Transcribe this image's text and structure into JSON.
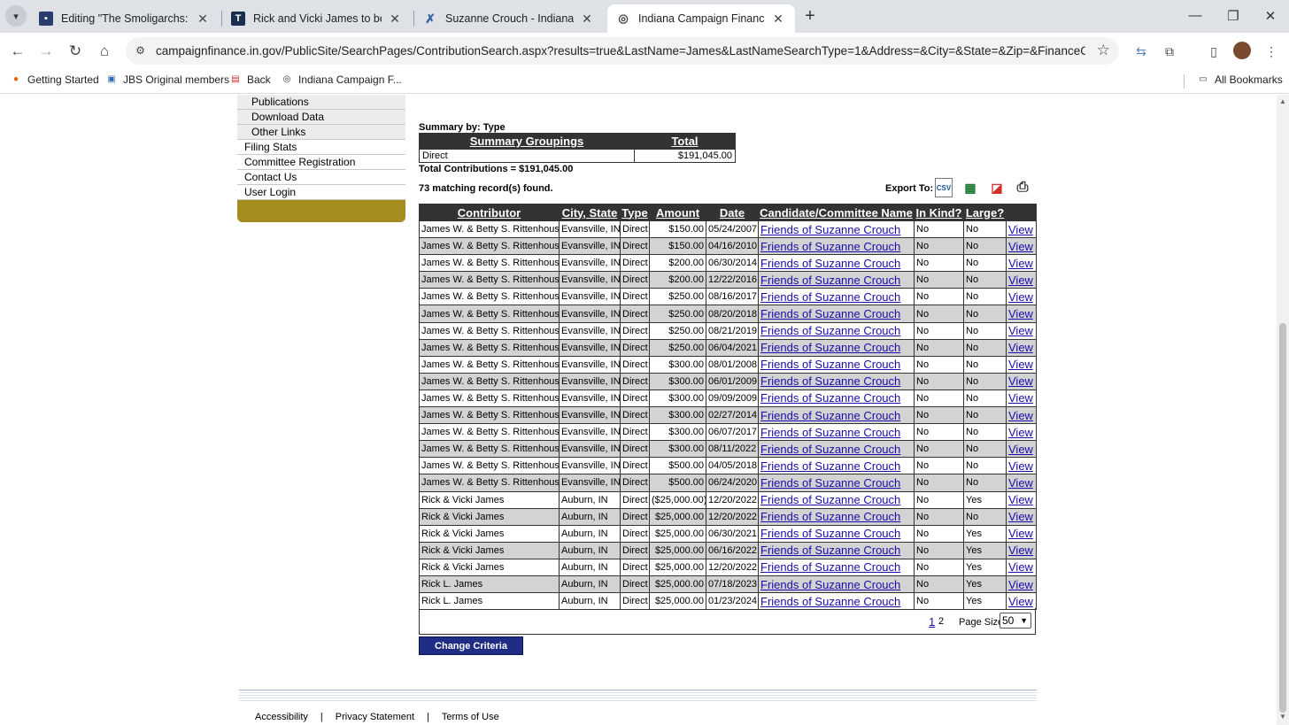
{
  "browser": {
    "tabs": [
      {
        "title": "Editing \"The Smoligarchs: Rick J",
        "icon": "site-favicon",
        "active": false
      },
      {
        "title": "Rick and Vicki James to be hono",
        "icon": "t-favicon",
        "active": false
      },
      {
        "title": "Suzanne Crouch - Indiana Cand",
        "icon": "ballot-favicon",
        "active": false
      },
      {
        "title": "Indiana Campaign Finance - Co",
        "icon": "globe-favicon",
        "active": true
      }
    ],
    "url": "campaignfinance.in.gov/PublicSite/SearchPages/ContributionSearch.aspx?results=true&LastName=James&LastNameSearchType=1&Address=&City=&State=&Zip=&FinanceCategoryID...",
    "bookmarks": [
      {
        "label": "Getting Started",
        "icon": "firefox-icon"
      },
      {
        "label": "JBS Original members",
        "icon": "doc-icon"
      },
      {
        "label": "Back",
        "icon": "back-icon"
      },
      {
        "label": "Indiana Campaign F...",
        "icon": "globe-icon"
      }
    ],
    "all_bookmarks": "All Bookmarks"
  },
  "leftnav": {
    "items": [
      {
        "label": "Publications",
        "sub": true
      },
      {
        "label": "Download Data",
        "sub": true
      },
      {
        "label": "Other Links",
        "sub": true
      },
      {
        "label": "Filing Stats",
        "sub": false
      },
      {
        "label": "Committee Registration",
        "sub": false
      },
      {
        "label": "Contact Us",
        "sub": false
      },
      {
        "label": "User Login",
        "sub": false
      }
    ]
  },
  "summary": {
    "label": "Summary by: Type",
    "headers": [
      "Summary Groupings",
      "Total"
    ],
    "row": [
      "Direct",
      "$191,045.00"
    ],
    "total_line": "Total Contributions = $191,045.00"
  },
  "matching": "73 matching record(s) found.",
  "export_label": "Export To:",
  "export_icons": [
    "csv-icon",
    "excel-icon",
    "pdf-icon",
    "printer-icon"
  ],
  "results": {
    "headers": [
      "Contributor",
      "City, State",
      "Type",
      "Amount",
      "Date",
      "Candidate/Committee Name",
      "In Kind?",
      "Large?",
      ""
    ],
    "rows": [
      [
        "James W. & Betty S. Rittenhouse",
        "Evansville, IN",
        "Direct",
        "$150.00",
        "05/24/2007",
        "Friends of Suzanne Crouch",
        "No",
        "No",
        "View"
      ],
      [
        "James W. & Betty S. Rittenhouse",
        "Evansville, IN",
        "Direct",
        "$150.00",
        "04/16/2010",
        "Friends of Suzanne Crouch",
        "No",
        "No",
        "View"
      ],
      [
        "James W. & Betty S. Rittenhouse",
        "Evansville, IN",
        "Direct",
        "$200.00",
        "06/30/2014",
        "Friends of Suzanne Crouch",
        "No",
        "No",
        "View"
      ],
      [
        "James W. & Betty S. Rittenhouse",
        "Evansville, IN",
        "Direct",
        "$200.00",
        "12/22/2016",
        "Friends of Suzanne Crouch",
        "No",
        "No",
        "View"
      ],
      [
        "James W. & Betty S. Rittenhouse",
        "Evansville, IN",
        "Direct",
        "$250.00",
        "08/16/2017",
        "Friends of Suzanne Crouch",
        "No",
        "No",
        "View"
      ],
      [
        "James W. & Betty S. Rittenhouse",
        "Evansville, IN",
        "Direct",
        "$250.00",
        "08/20/2018",
        "Friends of Suzanne Crouch",
        "No",
        "No",
        "View"
      ],
      [
        "James W. & Betty S. Rittenhouse",
        "Evansville, IN",
        "Direct",
        "$250.00",
        "08/21/2019",
        "Friends of Suzanne Crouch",
        "No",
        "No",
        "View"
      ],
      [
        "James W. & Betty S. Rittenhouse",
        "Evansville, IN",
        "Direct",
        "$250.00",
        "06/04/2021",
        "Friends of Suzanne Crouch",
        "No",
        "No",
        "View"
      ],
      [
        "James W. & Betty S. Rittenhouse",
        "Evansville, IN",
        "Direct",
        "$300.00",
        "08/01/2008",
        "Friends of Suzanne Crouch",
        "No",
        "No",
        "View"
      ],
      [
        "James W. & Betty S. Rittenhouse",
        "Evansville, IN",
        "Direct",
        "$300.00",
        "06/01/2009",
        "Friends of Suzanne Crouch",
        "No",
        "No",
        "View"
      ],
      [
        "James W. & Betty S. Rittenhouse",
        "Evansville, IN",
        "Direct",
        "$300.00",
        "09/09/2009",
        "Friends of Suzanne Crouch",
        "No",
        "No",
        "View"
      ],
      [
        "James W. & Betty S. Rittenhouse",
        "Evansville, IN",
        "Direct",
        "$300.00",
        "02/27/2014",
        "Friends of Suzanne Crouch",
        "No",
        "No",
        "View"
      ],
      [
        "James W. & Betty S. Rittenhouse",
        "Evansville, IN",
        "Direct",
        "$300.00",
        "06/07/2017",
        "Friends of Suzanne Crouch",
        "No",
        "No",
        "View"
      ],
      [
        "James W. & Betty S. Rittenhouse",
        "Evansville, IN",
        "Direct",
        "$300.00",
        "08/11/2022",
        "Friends of Suzanne Crouch",
        "No",
        "No",
        "View"
      ],
      [
        "James W. & Betty S. Rittenhouse",
        "Evansville, IN",
        "Direct",
        "$500.00",
        "04/05/2018",
        "Friends of Suzanne Crouch",
        "No",
        "No",
        "View"
      ],
      [
        "James W. & Betty S. Rittenhouse",
        "Evansville, IN",
        "Direct",
        "$500.00",
        "06/24/2020",
        "Friends of Suzanne Crouch",
        "No",
        "No",
        "View"
      ],
      [
        "Rick & Vicki James",
        "Auburn, IN",
        "Direct",
        "($25,000.00)",
        "12/20/2022",
        "Friends of Suzanne Crouch",
        "No",
        "Yes",
        "View"
      ],
      [
        "Rick & Vicki James",
        "Auburn, IN",
        "Direct",
        "$25,000.00",
        "12/20/2022",
        "Friends of Suzanne Crouch",
        "No",
        "No",
        "View"
      ],
      [
        "Rick & Vicki James",
        "Auburn, IN",
        "Direct",
        "$25,000.00",
        "06/30/2021",
        "Friends of Suzanne Crouch",
        "No",
        "Yes",
        "View"
      ],
      [
        "Rick & Vicki James",
        "Auburn, IN",
        "Direct",
        "$25,000.00",
        "06/16/2022",
        "Friends of Suzanne Crouch",
        "No",
        "Yes",
        "View"
      ],
      [
        "Rick & Vicki James",
        "Auburn, IN",
        "Direct",
        "$25,000.00",
        "12/20/2022",
        "Friends of Suzanne Crouch",
        "No",
        "Yes",
        "View"
      ],
      [
        "Rick L. James",
        "Auburn, IN",
        "Direct",
        "$25,000.00",
        "07/18/2023",
        "Friends of Suzanne Crouch",
        "No",
        "Yes",
        "View"
      ],
      [
        "Rick L. James",
        "Auburn, IN",
        "Direct",
        "$25,000.00",
        "01/23/2024",
        "Friends of Suzanne Crouch",
        "No",
        "Yes",
        "View"
      ]
    ]
  },
  "pager": {
    "page1": "1",
    "page2": "2",
    "size_label": "Page Size:",
    "size_value": "50"
  },
  "change_criteria": "Change Criteria",
  "footer": {
    "links": [
      "Accessibility",
      "Privacy Statement",
      "Terms of Use"
    ]
  }
}
